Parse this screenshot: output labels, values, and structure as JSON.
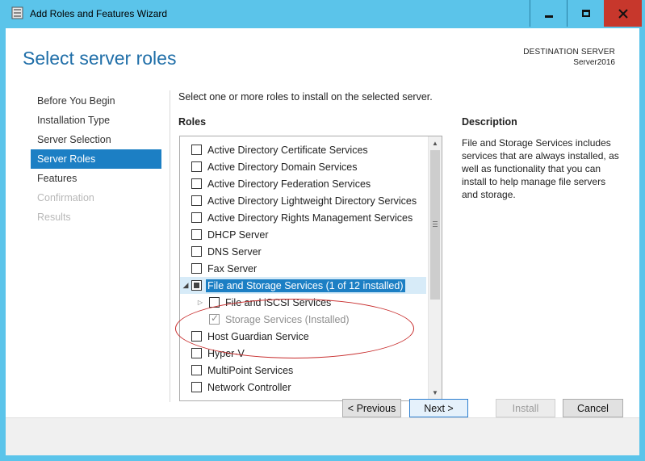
{
  "window": {
    "title": "Add Roles and Features Wizard",
    "controls": [
      "minimize",
      "maximize",
      "close"
    ]
  },
  "header": {
    "page_title": "Select server roles",
    "destination_label": "DESTINATION SERVER",
    "destination_server": "Server2016"
  },
  "nav": {
    "items": [
      {
        "label": "Before You Begin",
        "state": "normal"
      },
      {
        "label": "Installation Type",
        "state": "normal"
      },
      {
        "label": "Server Selection",
        "state": "normal"
      },
      {
        "label": "Server Roles",
        "state": "active"
      },
      {
        "label": "Features",
        "state": "normal"
      },
      {
        "label": "Confirmation",
        "state": "disabled"
      },
      {
        "label": "Results",
        "state": "disabled"
      }
    ]
  },
  "main": {
    "instruction": "Select one or more roles to install on the selected server.",
    "roles_heading": "Roles",
    "roles": [
      {
        "label": "Active Directory Certificate Services",
        "checked": false
      },
      {
        "label": "Active Directory Domain Services",
        "checked": false
      },
      {
        "label": "Active Directory Federation Services",
        "checked": false
      },
      {
        "label": "Active Directory Lightweight Directory Services",
        "checked": false
      },
      {
        "label": "Active Directory Rights Management Services",
        "checked": false
      },
      {
        "label": "DHCP Server",
        "checked": false
      },
      {
        "label": "DNS Server",
        "checked": false
      },
      {
        "label": "Fax Server",
        "checked": false
      },
      {
        "label": "File and Storage Services (1 of 12 installed)",
        "checked": "partial",
        "expanded": true,
        "selected": true
      },
      {
        "label": "File and iSCSI Services",
        "checked": false,
        "child": true,
        "collapsed": true
      },
      {
        "label": "Storage Services (Installed)",
        "checked": true,
        "child": true,
        "disabled": true
      },
      {
        "label": "Host Guardian Service",
        "checked": false
      },
      {
        "label": "Hyper-V",
        "checked": false
      },
      {
        "label": "MultiPoint Services",
        "checked": false
      },
      {
        "label": "Network Controller",
        "checked": false
      }
    ],
    "description_heading": "Description",
    "description_text": "File and Storage Services includes services that are always installed, as well as functionality that you can install to help manage file servers and storage."
  },
  "footer": {
    "previous_label": "< Previous",
    "next_label": "Next >",
    "install_label": "Install",
    "cancel_label": "Cancel"
  },
  "colors": {
    "titlebar": "#5bc4ea",
    "accent": "#1c7fc4",
    "page_title": "#1f6ea8",
    "close_button": "#c7372c",
    "annotation": "#c72a2a"
  }
}
